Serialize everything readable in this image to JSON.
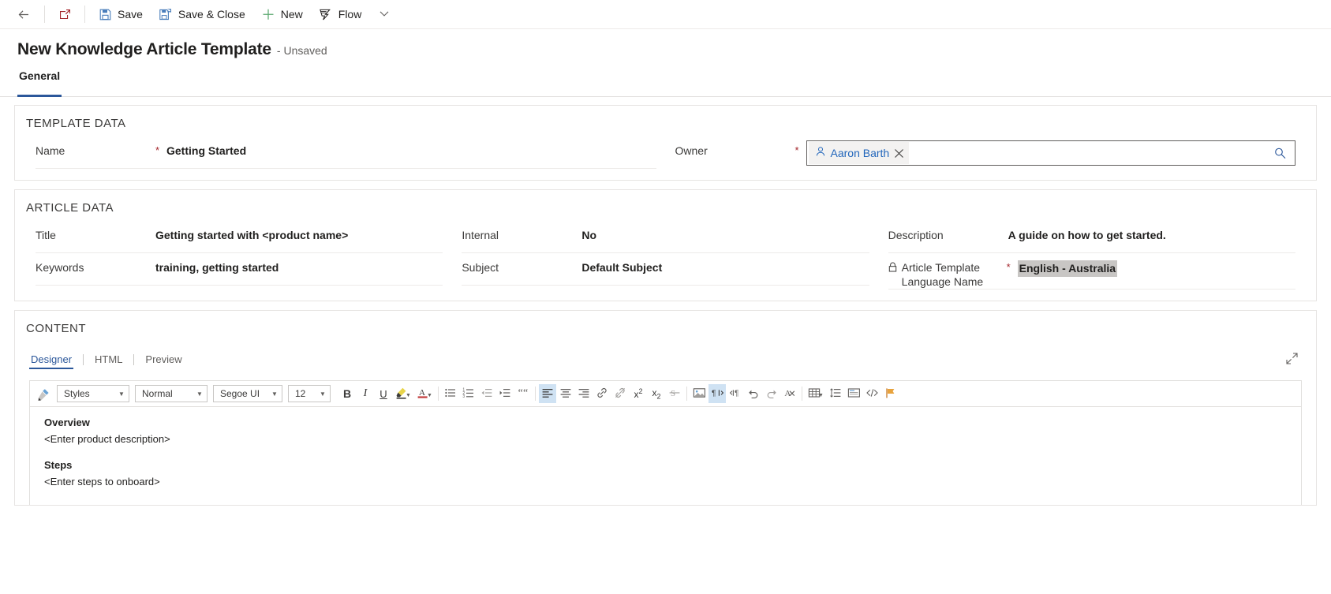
{
  "commandbar": {
    "back_icon": "back-arrow-icon",
    "popout_icon": "open-in-new-window-icon",
    "buttons": [
      {
        "label": "Save",
        "icon": "save-icon"
      },
      {
        "label": "Save & Close",
        "icon": "save-and-close-icon"
      },
      {
        "label": "New",
        "icon": "plus-icon"
      },
      {
        "label": "Flow",
        "icon": "flow-icon"
      }
    ],
    "overflow_icon": "chevron-down-icon"
  },
  "header": {
    "title": "New Knowledge Article Template",
    "subtitle": "- Unsaved"
  },
  "tabs": [
    {
      "label": "General",
      "active": true
    }
  ],
  "accent_color": "#2b579a",
  "required_color": "#a4262c",
  "link_color": "#2266bb",
  "sections": {
    "template_data": {
      "heading": "TEMPLATE DATA",
      "name": {
        "label": "Name",
        "required": "*",
        "value": "Getting Started"
      },
      "owner": {
        "label": "Owner",
        "required": "*",
        "chip_name": "Aaron Barth",
        "chip_icon": "person-icon",
        "remove_icon": "close-icon",
        "search_icon": "search-icon"
      }
    },
    "article_data": {
      "heading": "ARTICLE DATA",
      "column1": [
        {
          "label": "Title",
          "value": "Getting started with <product name>"
        },
        {
          "label": "Keywords",
          "value": "training, getting started"
        }
      ],
      "column2": [
        {
          "label": "Internal",
          "value": "No"
        },
        {
          "label": "Subject",
          "value": "Default Subject"
        }
      ],
      "column3": [
        {
          "label": "Description",
          "value": "A guide on how to get started."
        },
        {
          "label": "Article Template Language Name",
          "label_line1": "Article Template",
          "label_line2": "Language Name",
          "required": "*",
          "locked_icon": "lock-icon",
          "value": "English - Australia",
          "selected": true
        }
      ]
    },
    "content": {
      "heading": "CONTENT",
      "editor_tabs": [
        {
          "label": "Designer",
          "active": true
        },
        {
          "label": "HTML",
          "active": false
        },
        {
          "label": "Preview",
          "active": false
        }
      ],
      "expand_icon": "expand-diagonal-icon",
      "toolbar": {
        "format_painter_icon": "format-painter-icon",
        "selects": [
          {
            "name": "styles-select",
            "value": "Styles"
          },
          {
            "name": "format-select",
            "value": "Normal"
          },
          {
            "name": "font-family-select",
            "value": "Segoe UI"
          },
          {
            "name": "font-size-select",
            "value": "12"
          }
        ],
        "buttons": [
          {
            "name": "bold-button",
            "glyph": "B",
            "icon": "bold-icon"
          },
          {
            "name": "italic-button",
            "glyph": "I",
            "icon": "italic-icon"
          },
          {
            "name": "underline-button",
            "glyph": "U",
            "icon": "underline-icon"
          },
          {
            "name": "highlight-color-button",
            "icon": "highlighter-icon"
          },
          {
            "name": "font-color-button",
            "icon": "font-color-icon"
          },
          {
            "name": "bulleted-list-button",
            "icon": "bulleted-list-icon"
          },
          {
            "name": "numbered-list-button",
            "icon": "numbered-list-icon"
          },
          {
            "name": "decrease-indent-button",
            "icon": "decrease-indent-icon"
          },
          {
            "name": "increase-indent-button",
            "icon": "increase-indent-icon"
          },
          {
            "name": "blockquote-button",
            "icon": "quote-icon"
          },
          {
            "name": "align-left-button",
            "icon": "align-left-icon",
            "active": true
          },
          {
            "name": "align-center-button",
            "icon": "align-center-icon"
          },
          {
            "name": "align-right-button",
            "icon": "align-right-icon"
          },
          {
            "name": "insert-link-button",
            "icon": "link-icon"
          },
          {
            "name": "remove-link-button",
            "icon": "unlink-icon"
          },
          {
            "name": "superscript-button",
            "icon": "superscript-icon"
          },
          {
            "name": "subscript-button",
            "icon": "subscript-icon"
          },
          {
            "name": "strikethrough-button",
            "icon": "strikethrough-icon"
          },
          {
            "name": "insert-image-button",
            "icon": "image-icon"
          },
          {
            "name": "right-to-left-button",
            "icon": "rtl-icon",
            "active": true
          },
          {
            "name": "left-to-right-button",
            "icon": "ltr-icon"
          },
          {
            "name": "undo-button",
            "icon": "undo-icon"
          },
          {
            "name": "redo-button",
            "icon": "redo-icon"
          },
          {
            "name": "clear-formatting-button",
            "icon": "clear-format-icon"
          },
          {
            "name": "insert-table-button",
            "icon": "table-icon"
          },
          {
            "name": "line-spacing-button",
            "icon": "line-spacing-icon"
          },
          {
            "name": "insert-snippet-button",
            "icon": "insert-template-icon"
          },
          {
            "name": "source-code-button",
            "icon": "code-icon"
          },
          {
            "name": "flag-button",
            "icon": "flag-icon"
          }
        ]
      },
      "document": [
        {
          "type": "heading",
          "text": "Overview"
        },
        {
          "type": "paragraph",
          "text": "<Enter product description>"
        },
        {
          "type": "heading",
          "text": "Steps"
        },
        {
          "type": "paragraph",
          "text": "<Enter steps to onboard>"
        }
      ]
    }
  }
}
